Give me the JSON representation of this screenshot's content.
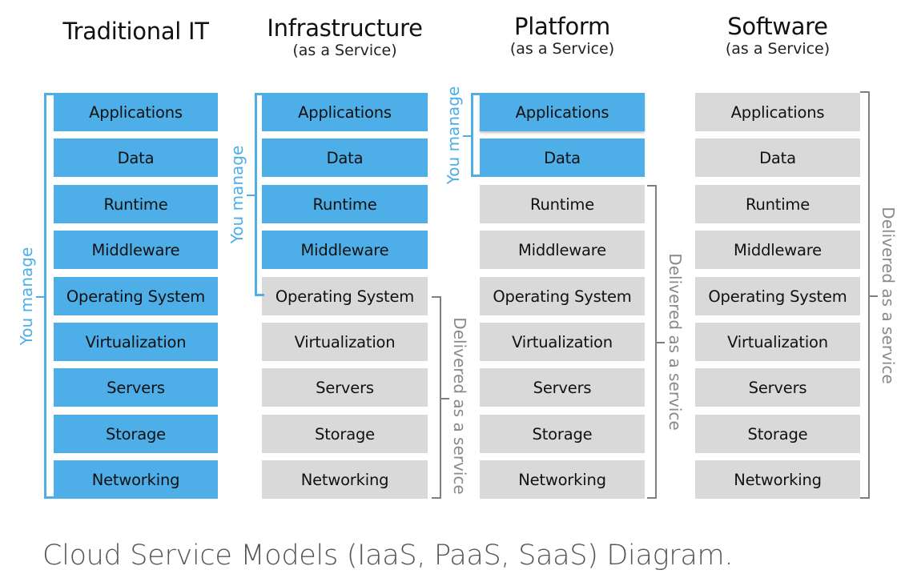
{
  "diagram": {
    "colors": {
      "managed": "#4daee8",
      "service": "#d9d9d9",
      "service_bracket": "#7f7f7f"
    },
    "layers": [
      "Applications",
      "Data",
      "Runtime",
      "Middleware",
      "Operating System",
      "Virtualization",
      "Servers",
      "Storage",
      "Networking"
    ],
    "columns": [
      {
        "title": "Traditional IT",
        "subtitle": "",
        "managed_count": 9,
        "managed_label": "You manage",
        "service_label": "",
        "layers": [
          "Applications",
          "Data",
          "Runtime",
          "Middleware",
          "Operating System",
          "Virtualization",
          "Servers",
          "Storage",
          "Networking"
        ]
      },
      {
        "title": "Infrastructure",
        "subtitle": "(as a Service)",
        "managed_count": 4,
        "managed_label": "You manage",
        "service_label": "Delivered as a service",
        "layers": [
          "Applications",
          "Data",
          "Runtime",
          "Middleware",
          "Operating System",
          "Virtualization",
          "Servers",
          "Storage",
          "Networking"
        ]
      },
      {
        "title": "Platform",
        "subtitle": "(as a Service)",
        "managed_count": 2,
        "managed_label": "You manage",
        "service_label": "Delivered as a service",
        "layers": [
          "Applications",
          "Data",
          "Runtime",
          "Middleware",
          "Operating System",
          "Virtualization",
          "Servers",
          "Storage",
          "Networking"
        ]
      },
      {
        "title": "Software",
        "subtitle": "(as a Service)",
        "managed_count": 0,
        "managed_label": "",
        "service_label": "Delivered as a service",
        "layers": [
          "Applications",
          "Data",
          "Runtime",
          "Middleware",
          "Operating System",
          "Virtualization",
          "Servers",
          "Storage",
          "Networking"
        ]
      }
    ]
  },
  "caption": "Cloud Service Models (IaaS, PaaS, SaaS) Diagram."
}
